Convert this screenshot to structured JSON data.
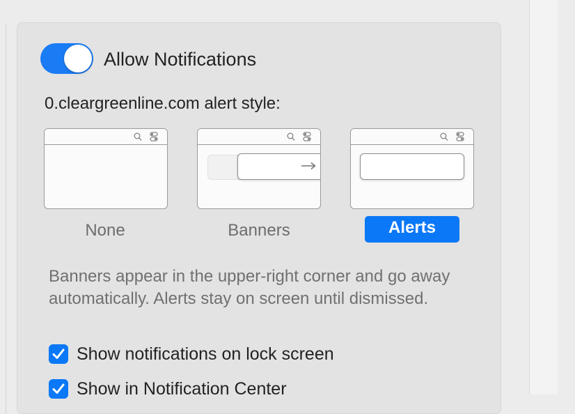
{
  "notifications": {
    "allow_label": "Allow Notifications",
    "allow_enabled": true,
    "alert_style_heading": "0.cleargreenline.com alert style:",
    "styles": [
      {
        "label": "None",
        "selected": false
      },
      {
        "label": "Banners",
        "selected": false
      },
      {
        "label": "Alerts",
        "selected": true
      }
    ],
    "description": "Banners appear in the upper-right corner and go away automatically. Alerts stay on screen until dismissed.",
    "options": [
      {
        "label": "Show notifications on lock screen",
        "checked": true
      },
      {
        "label": "Show in Notification Center",
        "checked": true
      }
    ]
  },
  "colors": {
    "accent": "#0a78f7",
    "panel_bg": "#e3e3e3"
  },
  "icons": {
    "thumb_search": "search-icon",
    "thumb_toggles": "toggles-icon",
    "banner_arrow": "arrow-right-icon",
    "checkmark": "checkmark-icon"
  }
}
